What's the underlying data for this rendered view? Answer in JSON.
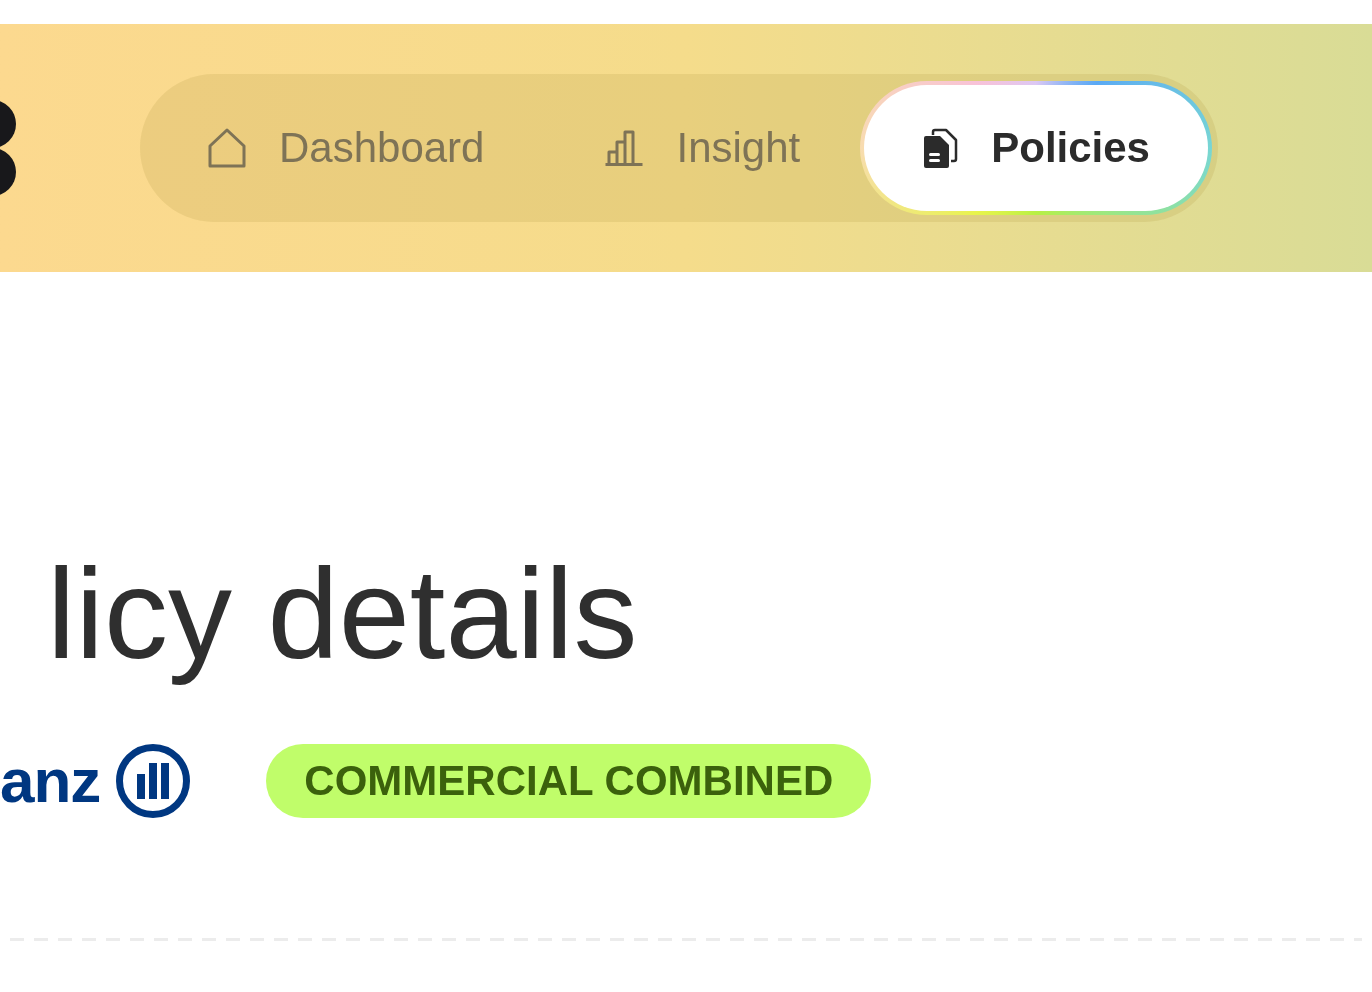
{
  "header": {
    "tabs": [
      {
        "label": "Dashboard",
        "selected": false
      },
      {
        "label": "Insight",
        "selected": false
      },
      {
        "label": "Policies",
        "selected": true
      }
    ]
  },
  "policy": {
    "title": "licy details",
    "insurer_logo": "anz",
    "badge": "COMMERCIAL COMBINED"
  }
}
